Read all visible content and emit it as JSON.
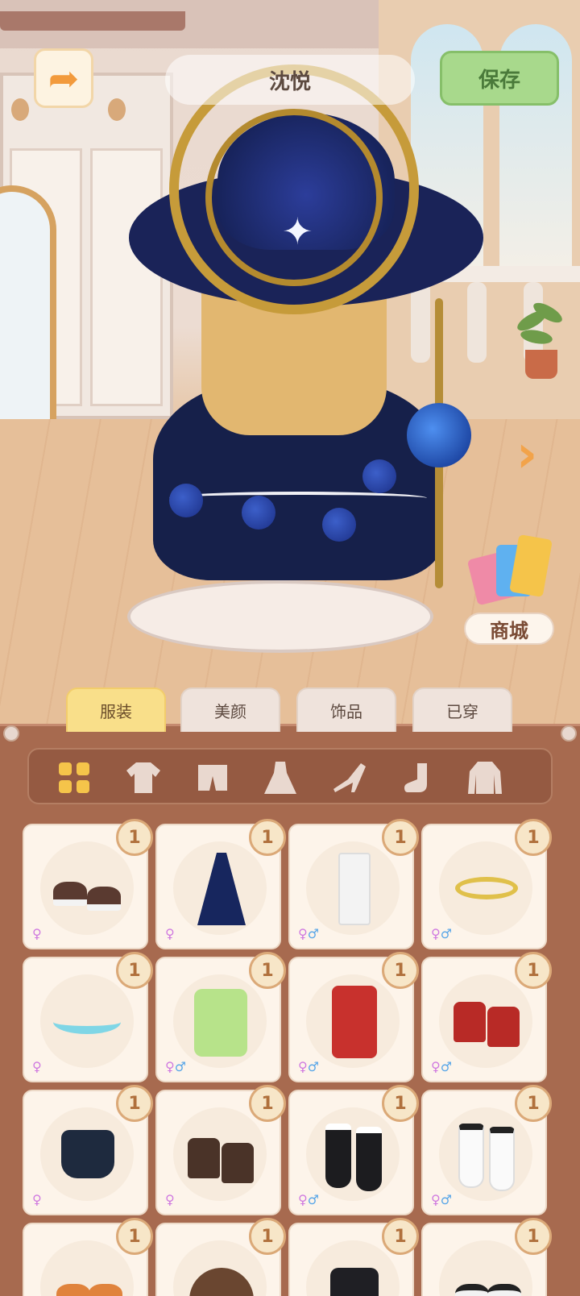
{
  "header": {
    "back_icon": "back-arrow-icon",
    "character_name": "沈悦",
    "save_label": "保存"
  },
  "scene": {
    "next_icon": "chevron-right-icon",
    "shop_label": "商城",
    "shop_icon": "shopping-bags-icon"
  },
  "tabs": [
    {
      "label": "服装",
      "active": true
    },
    {
      "label": "美颜",
      "active": false
    },
    {
      "label": "饰品",
      "active": false
    },
    {
      "label": "已穿",
      "active": false
    }
  ],
  "categories": [
    {
      "icon": "grid-all-icon",
      "active": true
    },
    {
      "icon": "top-icon",
      "active": false
    },
    {
      "icon": "bottoms-icon",
      "active": false
    },
    {
      "icon": "dress-icon",
      "active": false
    },
    {
      "icon": "heels-icon",
      "active": false
    },
    {
      "icon": "socks-icon",
      "active": false
    },
    {
      "icon": "coat-icon",
      "active": false
    }
  ],
  "items": [
    {
      "name": "brown-white-shoes",
      "count": "1",
      "gender": "♀"
    },
    {
      "name": "navy-star-gown",
      "count": "1",
      "gender": "♀"
    },
    {
      "name": "white-pants",
      "count": "1",
      "gender": "♀♂"
    },
    {
      "name": "gold-leaf-headband",
      "count": "1",
      "gender": "♀♂"
    },
    {
      "name": "cyan-scarf",
      "count": "1",
      "gender": "♀"
    },
    {
      "name": "green-yellow-jacket",
      "count": "1",
      "gender": "♀♂"
    },
    {
      "name": "red-outfit",
      "count": "1",
      "gender": "♀♂"
    },
    {
      "name": "red-boots",
      "count": "1",
      "gender": "♀♂"
    },
    {
      "name": "dark-crop-top",
      "count": "1",
      "gender": "♀"
    },
    {
      "name": "brown-boots",
      "count": "1",
      "gender": "♀"
    },
    {
      "name": "black-socks",
      "count": "1",
      "gender": "♀♂"
    },
    {
      "name": "white-socks",
      "count": "1",
      "gender": "♀♂"
    },
    {
      "name": "orange-shoes",
      "count": "1",
      "gender": ""
    },
    {
      "name": "brown-cloak",
      "count": "1",
      "gender": ""
    },
    {
      "name": "black-top",
      "count": "1",
      "gender": ""
    },
    {
      "name": "black-white-shoes",
      "count": "1",
      "gender": ""
    }
  ]
}
